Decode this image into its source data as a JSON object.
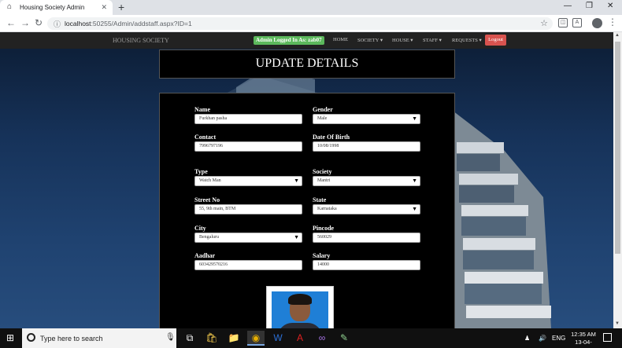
{
  "browser": {
    "tab_title": "Housing Society Admin",
    "url_host": "localhost",
    "url_rest": ":50255/Admin/addstaff.aspx?ID=1"
  },
  "topnav": {
    "brand": "HOUSING SOCIETY",
    "admin_badge": "Admin Logged In As: zab07",
    "links": [
      "HOME",
      "SOCIETY ▾",
      "HOUSE ▾",
      "STAFF ▾",
      "REQUESTS ▾"
    ],
    "logout": "Logout"
  },
  "page_title": "UPDATE DETAILS",
  "form": {
    "name_label": "Name",
    "name_value": "Furkhan pasha",
    "gender_label": "Gender",
    "gender_value": "Male",
    "contact_label": "Contact",
    "contact_value": "7996797196",
    "dob_label": "Date Of Birth",
    "dob_value": "10/08/1998",
    "type_label": "Type",
    "type_value": "Watch Man",
    "society_label": "Society",
    "society_value": "Mantri",
    "street_label": "Street No",
    "street_value": "55, 9th main, BTM",
    "state_label": "State",
    "state_value": "Karnataka",
    "city_label": "City",
    "city_value": "Bengaluru",
    "pincode_label": "Pincode",
    "pincode_value": "560029",
    "aadhar_label": "Aadhar",
    "aadhar_value": "603429570216",
    "salary_label": "Salary",
    "salary_value": "14000"
  },
  "taskbar": {
    "search_placeholder": "Type here to search",
    "lang": "ENG",
    "time": "12:35 AM",
    "date": "13-04-2019"
  }
}
